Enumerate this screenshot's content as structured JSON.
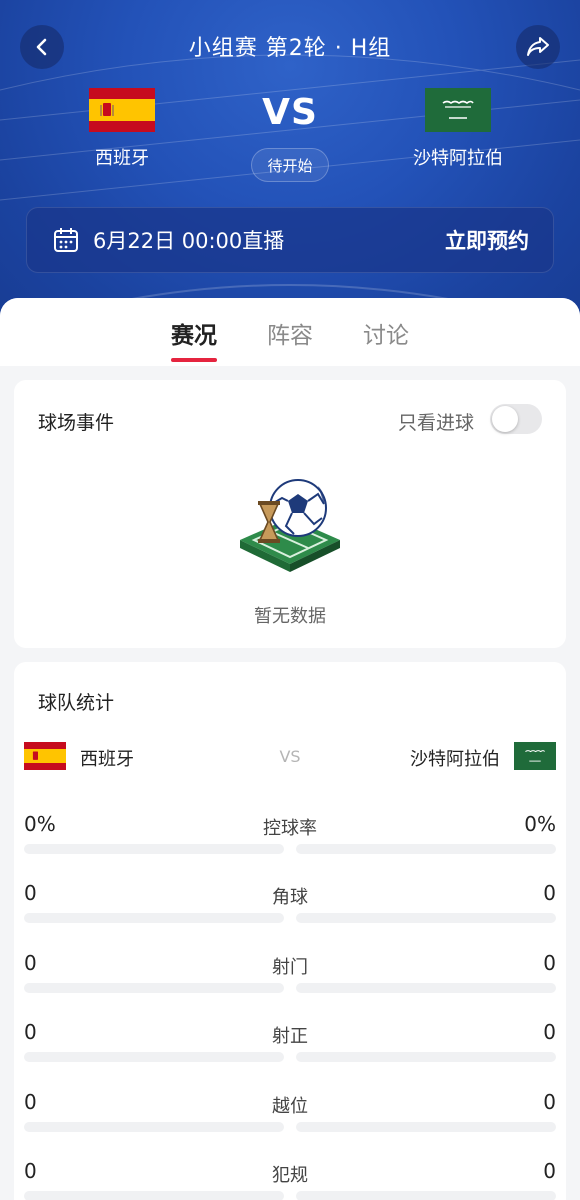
{
  "header": {
    "title": "小组赛 第2轮 · H组",
    "vs": "VS",
    "status": "待开始",
    "home_team": "西班牙",
    "away_team": "沙特阿拉伯",
    "broadcast_time": "6月22日 00:00直播",
    "reserve_label": "立即预约"
  },
  "tabs": [
    {
      "label": "赛况",
      "active": true
    },
    {
      "label": "阵容",
      "active": false
    },
    {
      "label": "讨论",
      "active": false
    }
  ],
  "events": {
    "title": "球场事件",
    "only_goals_label": "只看进球",
    "only_goals_on": false,
    "empty_text": "暂无数据"
  },
  "stats": {
    "title": "球队统计",
    "home_team": "西班牙",
    "away_team": "沙特阿拉伯",
    "vs": "VS",
    "rows": [
      {
        "label": "控球率",
        "home": "0%",
        "away": "0%",
        "home_fraction": 0,
        "away_fraction": 0
      },
      {
        "label": "角球",
        "home": "0",
        "away": "0",
        "home_fraction": 0,
        "away_fraction": 0
      },
      {
        "label": "射门",
        "home": "0",
        "away": "0",
        "home_fraction": 0,
        "away_fraction": 0
      },
      {
        "label": "射正",
        "home": "0",
        "away": "0",
        "home_fraction": 0,
        "away_fraction": 0
      },
      {
        "label": "越位",
        "home": "0",
        "away": "0",
        "home_fraction": 0,
        "away_fraction": 0
      },
      {
        "label": "犯规",
        "home": "0",
        "away": "0",
        "home_fraction": 0,
        "away_fraction": 0
      }
    ]
  },
  "colors": {
    "header_blue": "#2352b8",
    "accent_red": "#e5243f",
    "spain_red": "#c60b1e",
    "spain_yellow": "#ffc400",
    "saudi_green": "#1f6b3a"
  }
}
